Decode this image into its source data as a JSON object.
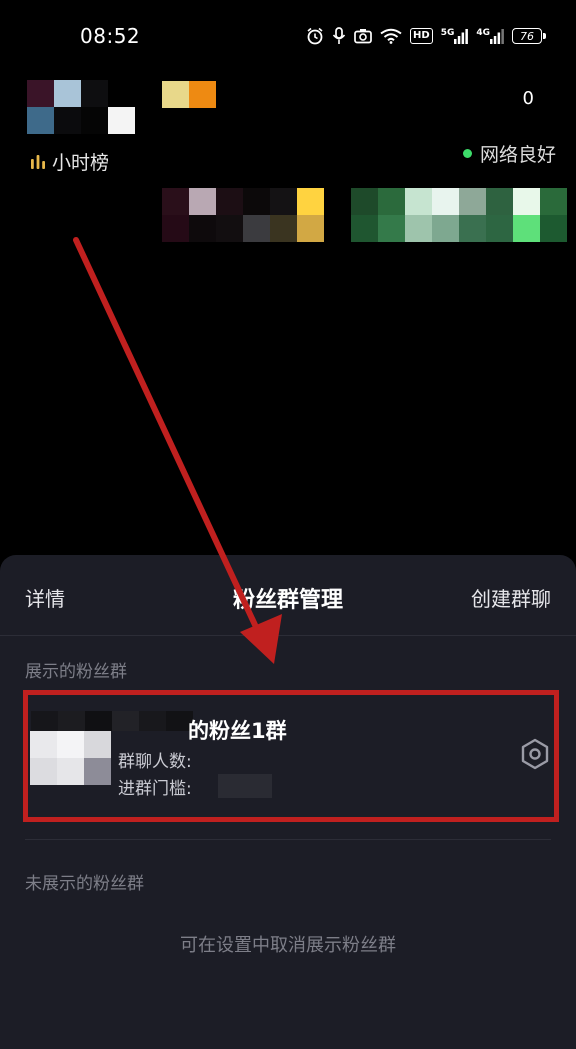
{
  "status_bar": {
    "time": "08:52",
    "hd_label": "HD",
    "net_1": "5G",
    "net_2": "4G",
    "battery": "76"
  },
  "live_header": {
    "viewer_count": "0",
    "rank_label": "小时榜",
    "network_status": "网络良好"
  },
  "sheet": {
    "details_label": "详情",
    "title": "粉丝群管理",
    "create_label": "创建群聊",
    "shown_section": "展示的粉丝群",
    "hidden_section": "未展示的粉丝群",
    "empty_hint": "可在设置中取消展示粉丝群",
    "groups": [
      {
        "name": "的粉丝1群",
        "members_label": "群聊人数:",
        "threshold_label": "进群门槛:"
      }
    ]
  },
  "colors": {
    "sheet_bg": "#1c1d26",
    "highlight_border": "#c0201f",
    "network_ok": "#3ddc6a"
  },
  "icons": {
    "rank": "bar-chart-icon",
    "settings": "gear-icon"
  }
}
